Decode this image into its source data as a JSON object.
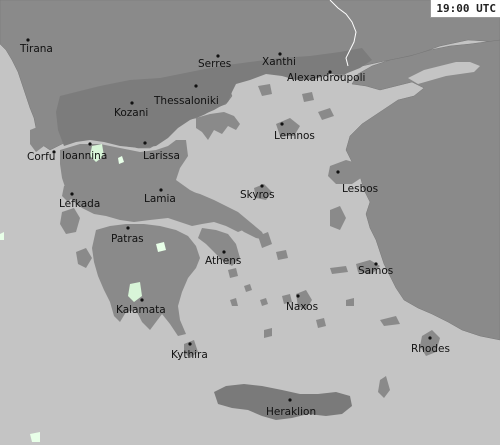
{
  "map": {
    "time_label": "19:00 UTC",
    "colors": {
      "sea": "#c4c4c4",
      "land": "#8a8a8a",
      "land_dark": "#7a7a7a",
      "border": "#ffffff",
      "rain": "#d8f5d8"
    },
    "cities": [
      {
        "id": "tirana",
        "name": "Tirana"
      },
      {
        "id": "serres",
        "name": "Serres"
      },
      {
        "id": "xanthi",
        "name": "Xanthi"
      },
      {
        "id": "alexandroupoli",
        "name": "Alexandroupoli"
      },
      {
        "id": "kozani",
        "name": "Kozani"
      },
      {
        "id": "thessaloniki",
        "name": "Thessaloniki"
      },
      {
        "id": "ioannina",
        "name": "Ioannina"
      },
      {
        "id": "corfu",
        "name": "Corfu"
      },
      {
        "id": "larissa",
        "name": "Larissa"
      },
      {
        "id": "lemnos",
        "name": "Lemnos"
      },
      {
        "id": "lamia",
        "name": "Lamia"
      },
      {
        "id": "skyros",
        "name": "Skyros"
      },
      {
        "id": "lesbos",
        "name": "Lesbos"
      },
      {
        "id": "lefkada",
        "name": "Lefkada"
      },
      {
        "id": "patras",
        "name": "Patras"
      },
      {
        "id": "athens",
        "name": "Athens"
      },
      {
        "id": "samos",
        "name": "Samos"
      },
      {
        "id": "naxos",
        "name": "Naxos"
      },
      {
        "id": "kalamata",
        "name": "Kalamata"
      },
      {
        "id": "kythira",
        "name": "Kythira"
      },
      {
        "id": "rhodes",
        "name": "Rhodes"
      },
      {
        "id": "heraklion",
        "name": "Heraklion"
      }
    ]
  }
}
